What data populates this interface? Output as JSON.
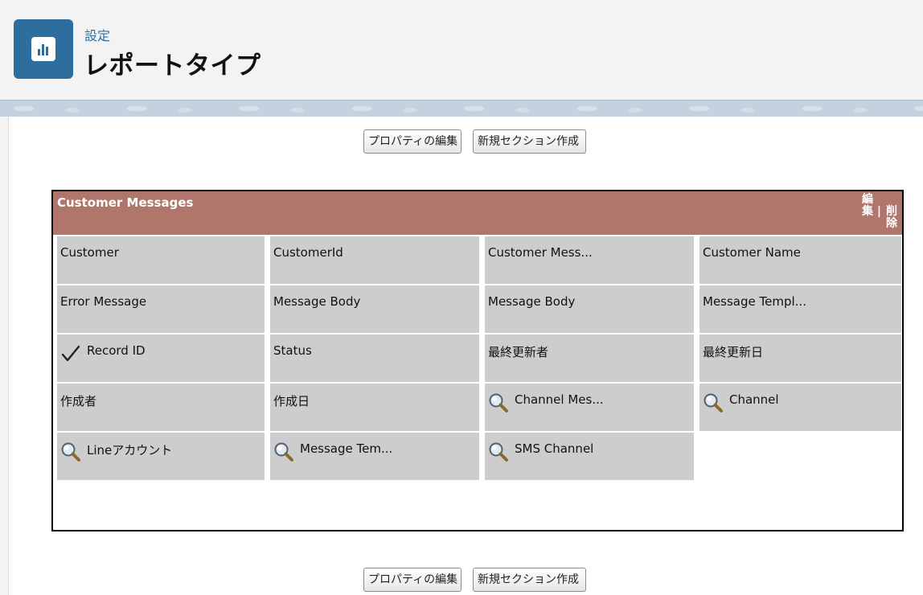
{
  "header": {
    "breadcrumb": "設定",
    "title": "レポートタイプ"
  },
  "toolbar": {
    "edit_properties": "プロパティの編集",
    "new_section": "新規セクション作成"
  },
  "section": {
    "title": "Customer Messages",
    "action_edit": "編集",
    "action_delete": "削除",
    "separator": "|",
    "fields": [
      {
        "label": "Customer",
        "icon": ""
      },
      {
        "label": "CustomerId",
        "icon": ""
      },
      {
        "label": "Customer Mess...",
        "icon": ""
      },
      {
        "label": "Customer Name",
        "icon": ""
      },
      {
        "label": "Error Message",
        "icon": ""
      },
      {
        "label": "Message Body",
        "icon": ""
      },
      {
        "label": "Message Body",
        "icon": ""
      },
      {
        "label": "Message Templ...",
        "icon": ""
      },
      {
        "label": "Record ID",
        "icon": "checkmark-icon"
      },
      {
        "label": "Status",
        "icon": ""
      },
      {
        "label": "最終更新者",
        "icon": ""
      },
      {
        "label": "最終更新日",
        "icon": ""
      },
      {
        "label": "作成者",
        "icon": ""
      },
      {
        "label": "作成日",
        "icon": ""
      },
      {
        "label": "Channel Mes...",
        "icon": "magnifier-icon"
      },
      {
        "label": "Channel",
        "icon": "magnifier-icon"
      },
      {
        "label": "Lineアカウント",
        "icon": "magnifier-icon"
      },
      {
        "label": "Message Tem...",
        "icon": "magnifier-icon"
      },
      {
        "label": "SMS Channel",
        "icon": "magnifier-icon"
      }
    ]
  },
  "colors": {
    "brand": "#2e6e9e",
    "section_header": "#b0756b",
    "field_cell": "#cdcdcd"
  }
}
